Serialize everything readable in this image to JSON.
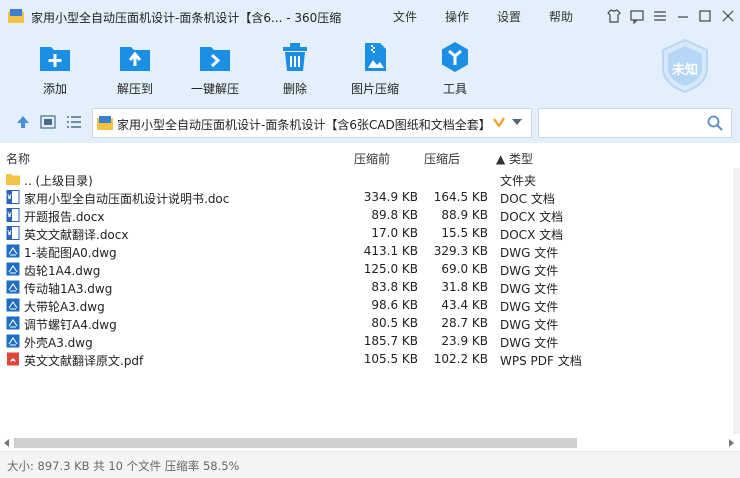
{
  "window": {
    "title": "家用小型全自动压面机设计-面条机设计【含6... - 360压缩",
    "menu": [
      "文件",
      "操作",
      "设置",
      "帮助"
    ]
  },
  "toolbar": {
    "items": [
      {
        "label": "添加",
        "icon": "add-icon"
      },
      {
        "label": "解压到",
        "icon": "extract-to-icon"
      },
      {
        "label": "一键解压",
        "icon": "one-click-extract-icon"
      },
      {
        "label": "删除",
        "icon": "delete-icon"
      },
      {
        "label": "图片压缩",
        "icon": "image-compress-icon"
      },
      {
        "label": "工具",
        "icon": "tools-icon"
      }
    ],
    "badge_label": "未知"
  },
  "address": {
    "path": "家用小型全自动压面机设计-面条机设计【含6张CAD图纸和文档全套】",
    "search_placeholder": ""
  },
  "columns": {
    "name": "名称",
    "compressed": "压缩前",
    "after": "压缩后",
    "type": "▲ 类型"
  },
  "files": [
    {
      "name": ".. (上级目录)",
      "before": "",
      "after": "",
      "type": "文件夹",
      "kind": "folder"
    },
    {
      "name": "家用小型全自动压面机设计说明书.doc",
      "before": "334.9 KB",
      "after": "164.5 KB",
      "type": "DOC 文档",
      "kind": "doc"
    },
    {
      "name": "开题报告.docx",
      "before": "89.8 KB",
      "after": "88.9 KB",
      "type": "DOCX 文档",
      "kind": "doc"
    },
    {
      "name": "英文文献翻译.docx",
      "before": "17.0 KB",
      "after": "15.5 KB",
      "type": "DOCX 文档",
      "kind": "doc"
    },
    {
      "name": "1-装配图A0.dwg",
      "before": "413.1 KB",
      "after": "329.3 KB",
      "type": "DWG 文件",
      "kind": "dwg"
    },
    {
      "name": "齿轮1A4.dwg",
      "before": "125.0 KB",
      "after": "69.0 KB",
      "type": "DWG 文件",
      "kind": "dwg"
    },
    {
      "name": "传动轴1A3.dwg",
      "before": "83.8 KB",
      "after": "31.8 KB",
      "type": "DWG 文件",
      "kind": "dwg"
    },
    {
      "name": "大带轮A3.dwg",
      "before": "98.6 KB",
      "after": "43.4 KB",
      "type": "DWG 文件",
      "kind": "dwg"
    },
    {
      "name": "调节螺钉A4.dwg",
      "before": "80.5 KB",
      "after": "28.7 KB",
      "type": "DWG 文件",
      "kind": "dwg"
    },
    {
      "name": "外壳A3.dwg",
      "before": "185.7 KB",
      "after": "23.9 KB",
      "type": "DWG 文件",
      "kind": "dwg"
    },
    {
      "name": "英文文献翻译原文.pdf",
      "before": "105.5 KB",
      "after": "102.2 KB",
      "type": "WPS PDF 文档",
      "kind": "pdf"
    }
  ],
  "status": "大小: 897.3 KB 共 10 个文件 压缩率 58.5%",
  "colors": {
    "accent": "#1a8fe3",
    "chrome": "#e3f0fb",
    "folder": "#f5c342",
    "pdf": "#e0453a"
  }
}
